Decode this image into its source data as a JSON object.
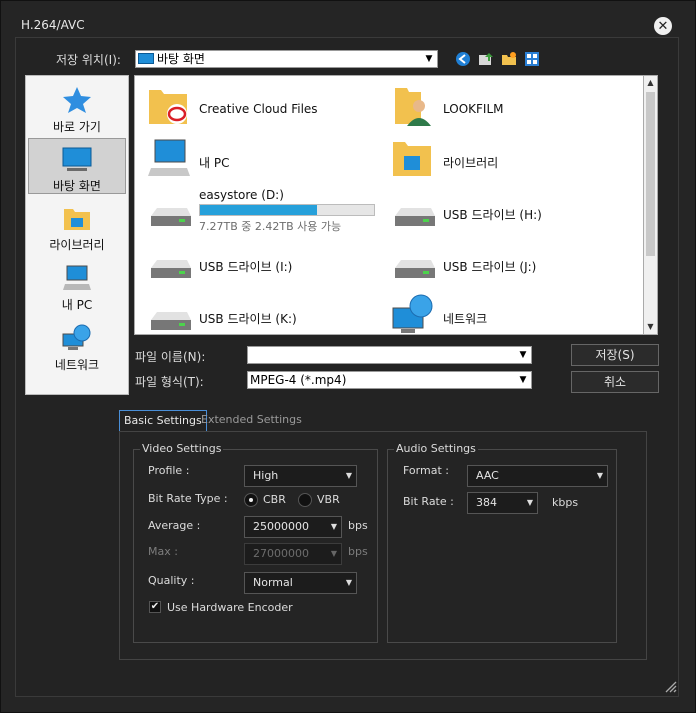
{
  "window": {
    "title": "H.264/AVC"
  },
  "location": {
    "label": "저장 위치(I):",
    "value": "바탕 화면"
  },
  "places": [
    {
      "label": "바로 가기",
      "icon": "quick-access-star-icon"
    },
    {
      "label": "바탕 화면",
      "icon": "desktop-icon",
      "selected": true
    },
    {
      "label": "라이브러리",
      "icon": "library-folder-icon"
    },
    {
      "label": "내 PC",
      "icon": "computer-icon"
    },
    {
      "label": "네트워크",
      "icon": "network-globe-icon"
    }
  ],
  "files": [
    {
      "name": "Creative Cloud Files",
      "icon": "creative-cloud-folder-icon"
    },
    {
      "name": "LOOKFILM",
      "icon": "user-folder-icon"
    },
    {
      "name": "내 PC",
      "icon": "computer-icon"
    },
    {
      "name": "라이브러리",
      "icon": "library-folder-icon"
    },
    {
      "name": "easystore (D:)",
      "icon": "hard-drive-icon",
      "used_fraction": 0.67,
      "info": "7.27TB 중 2.42TB 사용 가능"
    },
    {
      "name": "USB 드라이브 (H:)",
      "icon": "usb-drive-icon"
    },
    {
      "name": "USB 드라이브 (I:)",
      "icon": "usb-drive-icon"
    },
    {
      "name": "USB 드라이브 (J:)",
      "icon": "usb-drive-icon"
    },
    {
      "name": "USB 드라이브 (K:)",
      "icon": "usb-drive-icon"
    },
    {
      "name": "네트워크",
      "icon": "network-globe-icon"
    }
  ],
  "filename": {
    "label": "파일 이름(N):",
    "value": ""
  },
  "filetype": {
    "label": "파일 형식(T):",
    "value": "MPEG-4 (*.mp4)"
  },
  "buttons": {
    "save": "저장(S)",
    "cancel": "취소"
  },
  "tabs": {
    "basic": "Basic Settings",
    "extended": "Extended Settings"
  },
  "video": {
    "title": "Video Settings",
    "profile_label": "Profile :",
    "profile_value": "High",
    "bitrate_type_label": "Bit Rate Type :",
    "cbr": "CBR",
    "vbr": "VBR",
    "average_label": "Average :",
    "average_value": "25000000",
    "average_unit": "bps",
    "max_label": "Max :",
    "max_value": "27000000",
    "max_unit": "bps",
    "quality_label": "Quality :",
    "quality_value": "Normal",
    "hw_encoder": "Use Hardware Encoder",
    "check": "✔"
  },
  "audio": {
    "title": "Audio Settings",
    "format_label": "Format :",
    "format_value": "AAC",
    "bitrate_label": "Bit Rate :",
    "bitrate_value": "384",
    "bitrate_unit": "kbps"
  },
  "glyphs": {
    "close": "✕",
    "arrow": "▼",
    "up": "▲",
    "down": "▼"
  },
  "colors": {
    "accent": "#26a0da",
    "tab_border": "#4a8fd8"
  }
}
